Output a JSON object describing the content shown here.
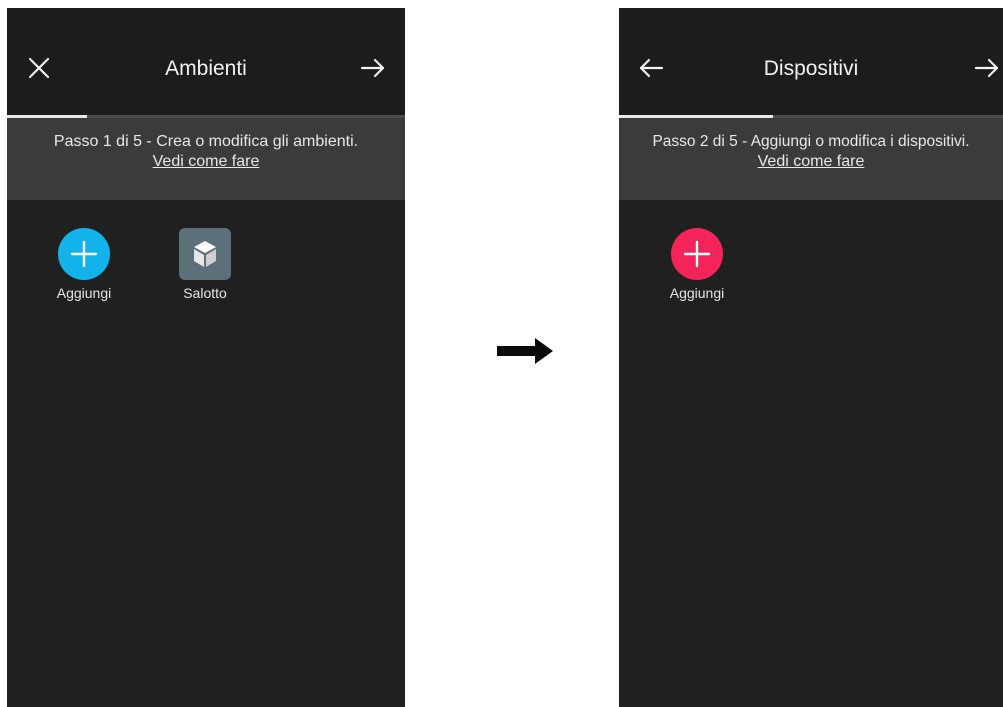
{
  "screens": [
    {
      "title": "Ambienti",
      "left_icon": "close-icon",
      "right_icon": "arrow-right-icon",
      "progress": 0.2,
      "step_text": "Passo 1 di 5 - Crea o modifica gli ambienti.",
      "step_link": "Vedi come fare",
      "tiles": [
        {
          "label": "Aggiungi",
          "icon": "plus-icon",
          "color": "#12b3ea"
        },
        {
          "label": "Salotto",
          "icon": "cube-icon",
          "color": "#5b7079"
        }
      ]
    },
    {
      "title": "Dispositivi",
      "left_icon": "arrow-left-icon",
      "right_icon": "arrow-right-icon",
      "progress": 0.4,
      "step_text": "Passo 2 di 5 - Aggiungi o modifica i dispositivi.",
      "step_link": "Vedi come fare",
      "tiles": [
        {
          "label": "Aggiungi",
          "icon": "plus-icon",
          "color": "#f2245a"
        }
      ]
    }
  ],
  "connector_icon": "arrow-right-icon"
}
